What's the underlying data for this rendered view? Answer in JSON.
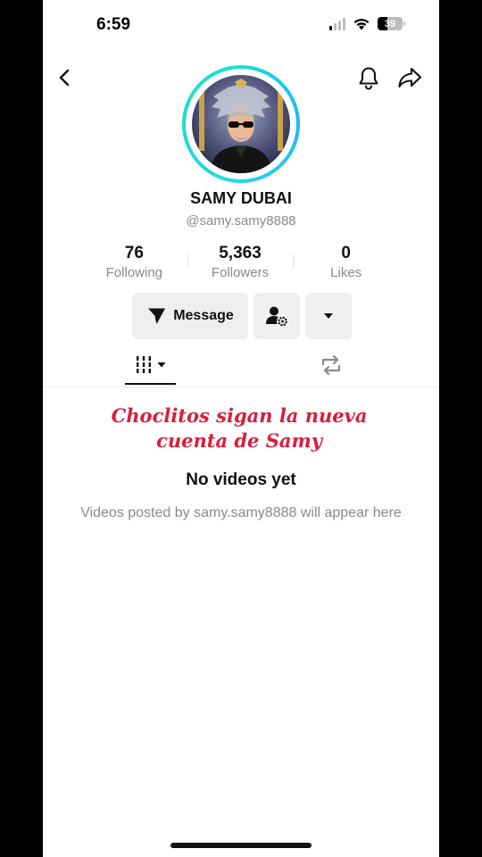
{
  "status_bar": {
    "time": "6:59",
    "battery_percent": "39",
    "signal_bars_active": 1,
    "icons": [
      "signal-icon",
      "wifi-icon",
      "battery-icon"
    ]
  },
  "nav": {
    "icons": [
      "back-chevron-icon",
      "bell-icon",
      "share-icon"
    ]
  },
  "profile": {
    "display_name": "SAMY DUBAI",
    "username": "@samy.samy8888",
    "ring_color": "#1fc6ef"
  },
  "stats": [
    {
      "value": "76",
      "label": "Following"
    },
    {
      "value": "5,363",
      "label": "Followers"
    },
    {
      "value": "0",
      "label": "Likes"
    }
  ],
  "actions": {
    "message_label": "Message",
    "icons": [
      "send-icon",
      "user-settings-icon",
      "caret-down-icon"
    ]
  },
  "tabs": {
    "icons": [
      "videos-grid-icon",
      "dropdown-caret-icon",
      "repost-icon"
    ]
  },
  "overlay_text": "Choclitos sigan la nueva cuenta de Samy",
  "overlay_color": "#d81e3a",
  "empty_state": {
    "title": "No videos yet",
    "description": "Videos posted by samy.samy8888 will appear here"
  }
}
